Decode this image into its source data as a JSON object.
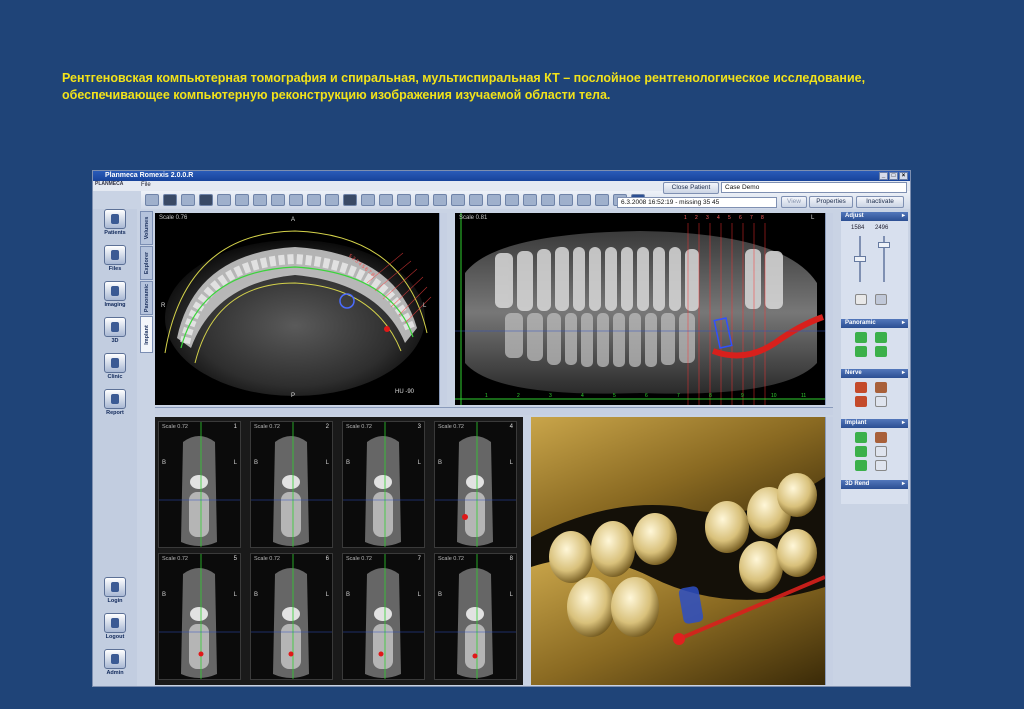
{
  "caption": {
    "line1": "Рентгеновская компьютерная томография и спиральная, мультиспиральная КТ – послойное рентгенологическое исследование,",
    "line2": "обеспечивающее компьютерную реконструкцию изображения изучаемой области тела."
  },
  "window": {
    "title": "Planmeca Romexis 2.0.0.R",
    "brand": "PLANMECA",
    "menu_file": "File"
  },
  "toolbar": {
    "close_patient": "Close Patient",
    "case_value": "Case Demo",
    "study_value": "6.3.2008 16:52:19 - missing 35 45",
    "view_label": "View",
    "properties_label": "Properties",
    "inactivate_label": "Inactivate"
  },
  "sidebar": {
    "items": [
      {
        "label": "Patients",
        "icon": "patients-icon"
      },
      {
        "label": "Files",
        "icon": "files-icon"
      },
      {
        "label": "Imaging",
        "icon": "imaging-icon"
      },
      {
        "label": "3D",
        "icon": "3d-icon"
      },
      {
        "label": "Clinic",
        "icon": "clinic-icon"
      },
      {
        "label": "Report",
        "icon": "report-icon"
      },
      {
        "label": "Login",
        "icon": "login-icon"
      },
      {
        "label": "Logout",
        "icon": "logout-icon"
      },
      {
        "label": "Admin",
        "icon": "admin-icon"
      }
    ]
  },
  "vtabs": [
    "Volumes",
    "Explorer",
    "Panoramic",
    "Implant"
  ],
  "axial": {
    "scale": "Scale 0.76",
    "hu": "HU -90",
    "a": "A",
    "p": "P",
    "r": "R",
    "l": "L",
    "marks": "5 2 3 4 5 6 7 8"
  },
  "panoramic": {
    "scale": "Scale 0.81",
    "l": "L",
    "top_numbers": [
      "1",
      "2",
      "3",
      "4",
      "5",
      "6",
      "7",
      "8"
    ],
    "bottom_numbers": [
      "1",
      "2",
      "3",
      "4",
      "5",
      "6",
      "7",
      "8",
      "9",
      "10",
      "11"
    ]
  },
  "slices": [
    {
      "scale": "Scale 0.72",
      "num": "1"
    },
    {
      "scale": "Scale 0.72",
      "num": "2"
    },
    {
      "scale": "Scale 0.72",
      "num": "3"
    },
    {
      "scale": "Scale 0.72",
      "num": "4"
    },
    {
      "scale": "Scale 0.72",
      "num": "5"
    },
    {
      "scale": "Scale 0.72",
      "num": "6"
    },
    {
      "scale": "Scale 0.72",
      "num": "7"
    },
    {
      "scale": "Scale 0.72",
      "num": "8"
    }
  ],
  "slice_labels": {
    "b": "B",
    "l": "L"
  },
  "right_panel": {
    "adjust": "Adjust",
    "value_low": "1584",
    "value_high": "2496",
    "panoramic": "Panoramic",
    "nerve": "Nerve",
    "implant": "Implant",
    "render3d": "3D Rend"
  },
  "colors": {
    "slide_bg": "#1f4478",
    "caption": "#f2e21a",
    "nerve": "#d8201c",
    "implant": "#2d4fc4"
  }
}
